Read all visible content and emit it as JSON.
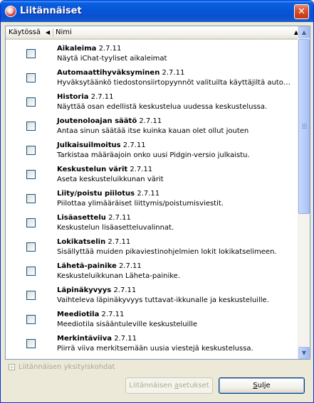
{
  "window": {
    "title": "Liitännäiset",
    "close_glyph": "✕"
  },
  "list": {
    "columns": {
      "enabled": "Käytössä",
      "name": "Nimi",
      "sort_glyph": "◀",
      "overflow_glyph": "▲"
    },
    "plugins": [
      {
        "name": "Aikaleima",
        "version": "2.7.11",
        "description": "Näytä iChat-tyyliset aikaleimat",
        "enabled": false
      },
      {
        "name": "Automaattihyväksyminen",
        "version": "2.7.11",
        "description": "Hyväksytäänkö tiedostonsiirtopyynnöt valituilta käyttäjiltä automa...",
        "enabled": false
      },
      {
        "name": "Historia",
        "version": "2.7.11",
        "description": "Näyttää osan edellistä keskustelua uudessa keskustelussa.",
        "enabled": false
      },
      {
        "name": "Joutenoloajan säätö",
        "version": "2.7.11",
        "description": "Antaa sinun säätää itse kuinka kauan olet ollut jouten",
        "enabled": false
      },
      {
        "name": "Julkaisuilmoitus",
        "version": "2.7.11",
        "description": "Tarkistaa määräajoin onko uusi Pidgin-versio julkaistu.",
        "enabled": false
      },
      {
        "name": "Keskustelun värit",
        "version": "2.7.11",
        "description": "Aseta keskusteluikkunan värit",
        "enabled": false
      },
      {
        "name": "Liity/poistu piilotus",
        "version": "2.7.11",
        "description": "Piilottaa ylimääräiset liittymis/poistumisviestit.",
        "enabled": false
      },
      {
        "name": "Lisäasettelu",
        "version": "2.7.11",
        "description": "Keskustelun lisäasetteluvalinnat.",
        "enabled": false
      },
      {
        "name": "Lokikatselin",
        "version": "2.7.11",
        "description": "Sisällyttää muiden pikaviestinohjelmien lokit lokikatselimeen.",
        "enabled": false
      },
      {
        "name": "Lähetä-painike",
        "version": "2.7.11",
        "description": "Keskusteluikkunan Läheta-painike.",
        "enabled": false
      },
      {
        "name": "Läpinäkyvyys",
        "version": "2.7.11",
        "description": "Vaihteleva läpinäkyvyys tuttavat-ikkunalle ja keskusteluille.",
        "enabled": false
      },
      {
        "name": "Meediotila",
        "version": "2.7.11",
        "description": "Meediotila sisääntuleville keskusteluille",
        "enabled": false
      },
      {
        "name": "Merkintäviiva",
        "version": "2.7.11",
        "description": "Piirrä viiva merkitsemään uusia viestejä keskustelussa.",
        "enabled": false
      }
    ],
    "scrollbar": {
      "up_glyph": "▲",
      "down_glyph": "▼",
      "position": 0.0
    }
  },
  "details": {
    "expander_glyph": "+",
    "label": "Liitännäisen yksityiskohdat"
  },
  "buttons": {
    "configure_pre": "Liitännäisen ",
    "configure_ul": "a",
    "configure_post": "setukset",
    "close_ul": "S",
    "close_post": "ulje"
  }
}
